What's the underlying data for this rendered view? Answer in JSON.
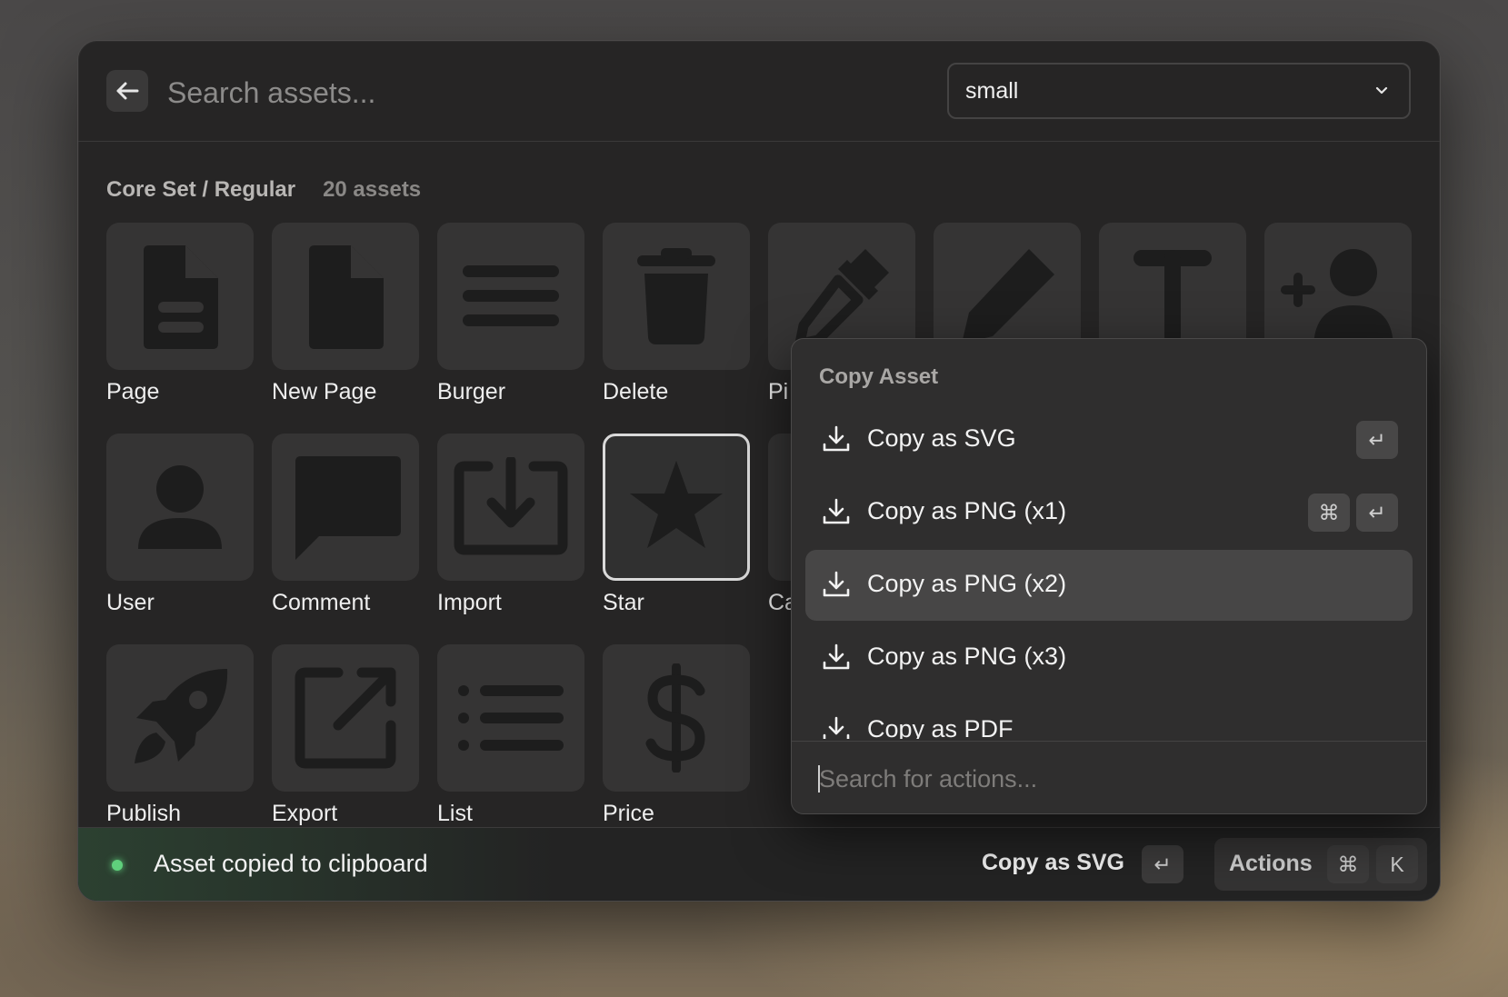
{
  "header": {
    "search_placeholder": "Search assets...",
    "size_select_value": "small"
  },
  "section": {
    "title": "Core Set / Regular",
    "count": "20 assets"
  },
  "assets": [
    {
      "label": "Page",
      "icon": "page-icon"
    },
    {
      "label": "New Page",
      "icon": "new-page-icon"
    },
    {
      "label": "Burger",
      "icon": "burger-icon"
    },
    {
      "label": "Delete",
      "icon": "trash-icon"
    },
    {
      "label": "Pi",
      "icon": "pipette-icon"
    },
    {
      "label": "",
      "icon": "pencil-icon"
    },
    {
      "label": "",
      "icon": "text-icon"
    },
    {
      "label": "",
      "icon": "add-user-icon"
    },
    {
      "label": "User",
      "icon": "user-icon"
    },
    {
      "label": "Comment",
      "icon": "comment-icon"
    },
    {
      "label": "Import",
      "icon": "import-icon"
    },
    {
      "label": "Star",
      "icon": "star-icon"
    },
    {
      "label": "Ca",
      "icon": ""
    },
    {
      "label": "Publish",
      "icon": "rocket-icon"
    },
    {
      "label": "Export",
      "icon": "export-icon"
    },
    {
      "label": "List",
      "icon": "list-icon"
    },
    {
      "label": "Price",
      "icon": "dollar-icon"
    }
  ],
  "popup": {
    "title": "Copy Asset",
    "items": [
      {
        "label": "Copy as SVG",
        "shortcut": [
          "↵"
        ]
      },
      {
        "label": "Copy as PNG (x1)",
        "shortcut": [
          "⌘",
          "↵"
        ]
      },
      {
        "label": "Copy as PNG (x2)",
        "shortcut": [],
        "active": true
      },
      {
        "label": "Copy as PNG (x3)",
        "shortcut": []
      },
      {
        "label": "Copy as PDF",
        "shortcut": []
      }
    ],
    "search_placeholder": "Search for actions..."
  },
  "footer": {
    "status": "Asset copied to clipboard",
    "primary_action": "Copy as SVG",
    "primary_key": "↵",
    "actions_label": "Actions",
    "actions_keys": [
      "⌘",
      "K"
    ]
  },
  "colors": {
    "status_green": "#5fd07c",
    "window_bg": "#262525",
    "tile_bg": "#353434"
  }
}
